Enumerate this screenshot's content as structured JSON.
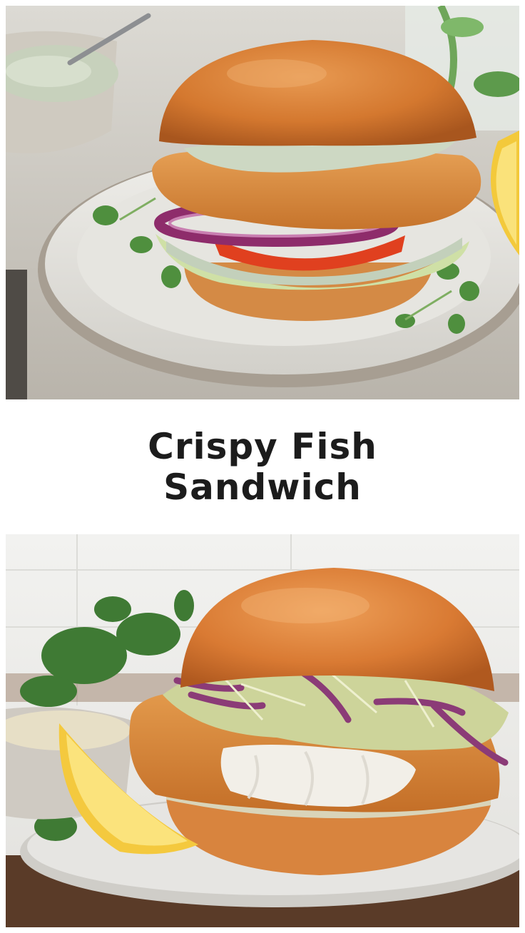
{
  "title": "Crispy Fish Sandwich",
  "photos": [
    {
      "subject": "fish-sandwich-with-tartar-sauce-onion-tomato-lettuce",
      "colors": {
        "bun": "#d9823d",
        "fish": "#d98a3f",
        "sauce": "#c9d3c0",
        "onion": "#9b2f6e",
        "tomato": "#e3421e",
        "lemon": "#f6d34f",
        "plate": "#e9e8e4",
        "background": "#c9c6bf"
      }
    },
    {
      "subject": "fish-sandwich-with-coleslaw-and-lemon-wedge",
      "colors": {
        "bun": "#dc8138",
        "fish": "#d98a3f",
        "flake": "#f2efe8",
        "slaw": "#cfd59a",
        "cabbage": "#8c3c78",
        "lemon": "#f6d34f",
        "plate": "#e4e3e0",
        "table": "#5a3b28",
        "background": "#ececea"
      }
    }
  ]
}
